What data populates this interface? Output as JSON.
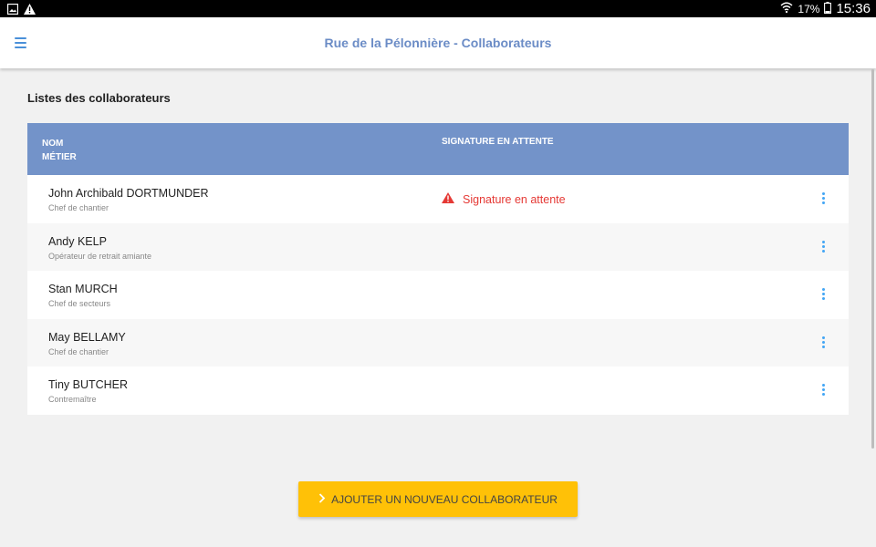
{
  "status_bar": {
    "battery": "17%",
    "time": "15:36",
    "icons": [
      "gallery-icon",
      "warning-icon",
      "wifi-icon",
      "battery-icon"
    ]
  },
  "app_bar": {
    "title": "Rue de la Pélonnière - Collaborateurs",
    "accent_color": "#6b8cc6",
    "menu_icon": "menu-icon"
  },
  "main": {
    "section_title": "Listes des collaborateurs",
    "table": {
      "header_color": "#7393c9",
      "col_name": "NOM",
      "col_job": "MÉTIER",
      "col_signature": "SIGNATURE EN ATTENTE",
      "rows": [
        {
          "name": "John Archibald DORTMUNDER",
          "job": "Chef de chantier",
          "signature": "Signature en attente"
        },
        {
          "name": "Andy KELP",
          "job": "Opérateur de retrait amiante",
          "signature": ""
        },
        {
          "name": "Stan MURCH",
          "job": "Chef de secteurs",
          "signature": ""
        },
        {
          "name": "May BELLAMY",
          "job": "Chef de chantier",
          "signature": ""
        },
        {
          "name": "Tiny BUTCHER",
          "job": "Contremaître",
          "signature": ""
        }
      ]
    },
    "warning_color": "#e53935",
    "add_button": {
      "label": "AJOUTER UN NOUVEAU COLLABORATEUR",
      "color": "#ffc107",
      "icon": "chevron-right-icon"
    }
  }
}
